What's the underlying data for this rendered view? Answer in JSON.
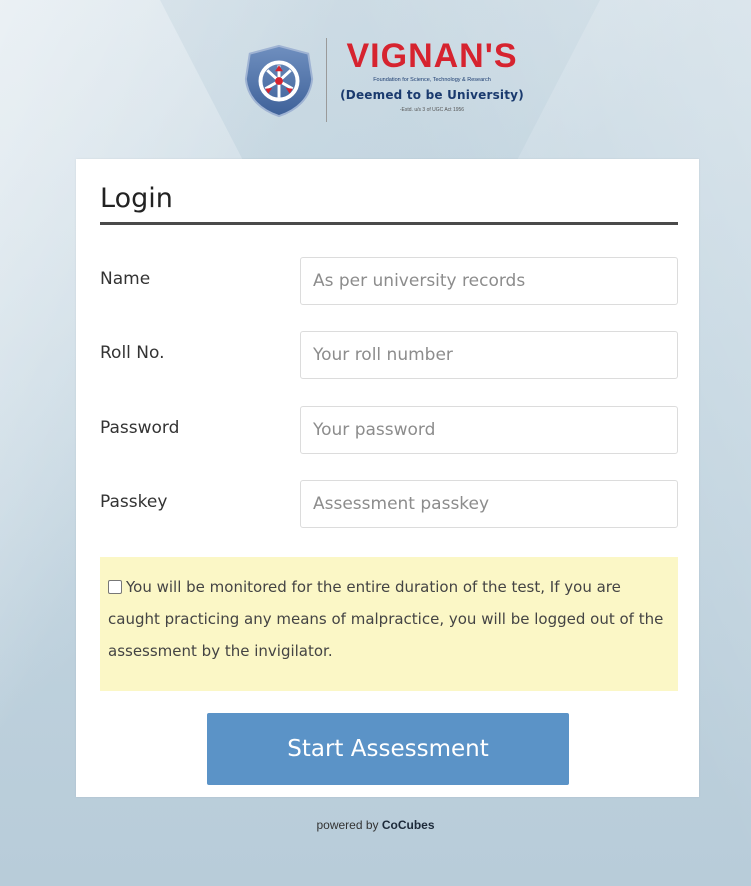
{
  "brand": {
    "name": "VIGNAN'S",
    "subtitle": "Foundation for Science, Technology & Research",
    "deemed": "(Deemed to be University)",
    "estd": "-Estd. u/s 3 of UGC Act 1956",
    "accent_color": "#d6232f",
    "secondary_color": "#1a3a6e",
    "emblem_icon": "university-emblem-icon"
  },
  "login": {
    "title": "Login",
    "fields": [
      {
        "label": "Name",
        "placeholder": "As per university records",
        "value": ""
      },
      {
        "label": "Roll No.",
        "placeholder": "Your roll number",
        "value": ""
      },
      {
        "label": "Password",
        "placeholder": "Your password",
        "value": ""
      },
      {
        "label": "Passkey",
        "placeholder": "Assessment passkey",
        "value": ""
      }
    ],
    "notice": "You will be monitored for the entire duration of the test, If you are caught practicing any means of malpractice, you will be logged out of the assessment by the invigilator.",
    "notice_color": "#fbf7c6",
    "submit_label": "Start Assessment",
    "submit_color": "#5b93c7"
  },
  "footer": {
    "prefix": "powered by",
    "brand": "CoCubes"
  }
}
